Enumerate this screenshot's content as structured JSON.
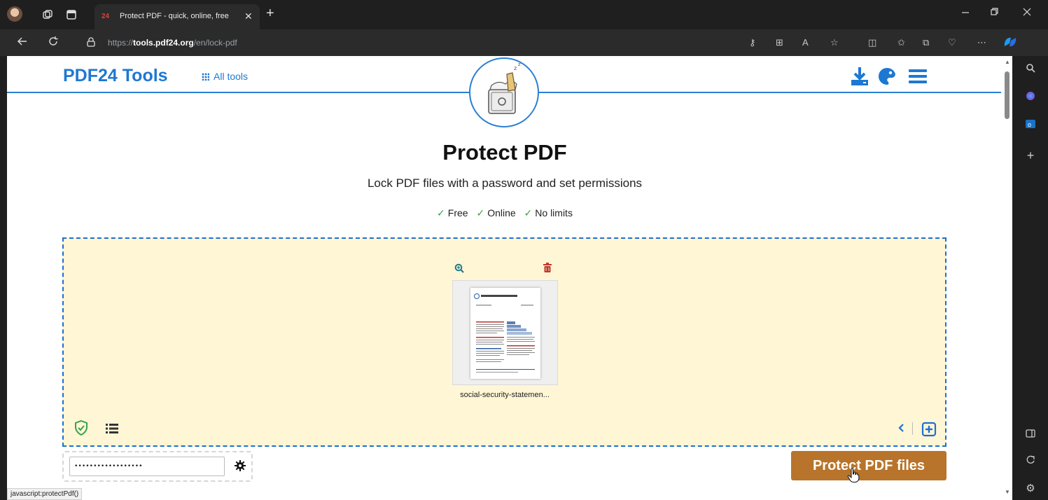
{
  "browser": {
    "tab_title": "Protect PDF - quick, online, free",
    "tab_close": "✕",
    "new_tab": "+",
    "url_prefix": "https://",
    "url_domain": "tools.pdf24.org",
    "url_path": "/en/lock-pdf",
    "status_text": "javascript:protectPdf()"
  },
  "header": {
    "brand": "PDF24 Tools",
    "all_tools": "All tools"
  },
  "hero": {
    "title": "Protect PDF",
    "subtitle": "Lock PDF files with a password and set permissions",
    "features": [
      "Free",
      "Online",
      "No limits"
    ],
    "check_mark": "✓"
  },
  "dropzone": {
    "file_name": "social-security-statemen..."
  },
  "password": {
    "value": "••••••••••••••••••"
  },
  "actions": {
    "protect_label": "Protect PDF files"
  },
  "colors": {
    "brand_blue": "#1e78d2",
    "dropzone_bg": "#fff6d6",
    "button": "#b8742a"
  }
}
